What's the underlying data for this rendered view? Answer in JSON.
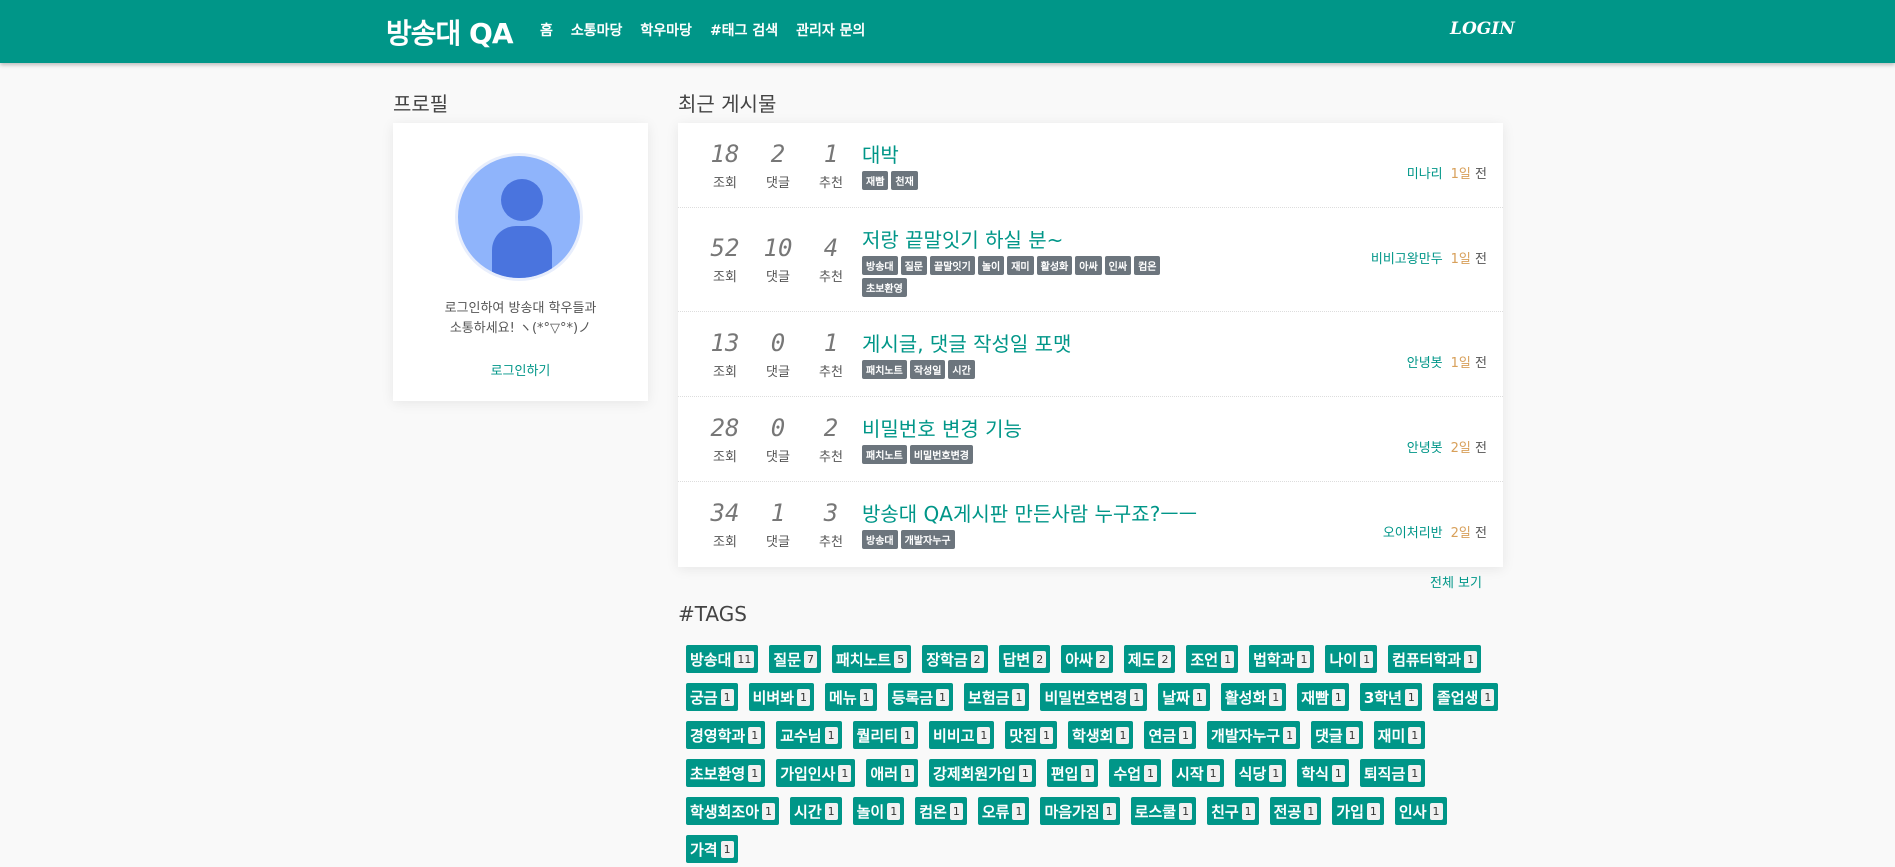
{
  "header": {
    "brand": "방송대 QA",
    "nav": [
      "홈",
      "소통마당",
      "학우마당",
      "#태그 검색",
      "관리자 문의"
    ],
    "login": "LOGIN"
  },
  "profile": {
    "title": "프로필",
    "message_line1": "로그인하여 방송대 학우들과",
    "message_line2": "소통하세요! ヽ(*°▽°*)ノ",
    "login_link": "로그인하기"
  },
  "recent": {
    "title": "최근 게시물",
    "labels": {
      "views": "조회",
      "comments": "댓글",
      "likes": "추천"
    },
    "view_all": "전체 보기",
    "posts": [
      {
        "views": "18",
        "comments": "2",
        "likes": "1",
        "title": "대박",
        "tags": [
          "재빰",
          "천재"
        ],
        "author": "미나리",
        "days": "1일",
        "ago": "전"
      },
      {
        "views": "52",
        "comments": "10",
        "likes": "4",
        "title": "저랑 끝말잇기 하실 분~",
        "tags": [
          "방송대",
          "질문",
          "끝말잇기",
          "놀이",
          "재미",
          "활성화",
          "아싸",
          "인싸",
          "컴온",
          "초보환영"
        ],
        "author": "비비고왕만두",
        "days": "1일",
        "ago": "전"
      },
      {
        "views": "13",
        "comments": "0",
        "likes": "1",
        "title": "게시글, 댓글 작성일 포맷",
        "tags": [
          "패치노트",
          "작성일",
          "시간"
        ],
        "author": "안녕봇",
        "days": "1일",
        "ago": "전"
      },
      {
        "views": "28",
        "comments": "0",
        "likes": "2",
        "title": "비밀번호 변경 기능",
        "tags": [
          "패치노트",
          "비밀번호변경"
        ],
        "author": "안녕봇",
        "days": "2일",
        "ago": "전"
      },
      {
        "views": "34",
        "comments": "1",
        "likes": "3",
        "title": "방송대 QA게시판 만든사람 누구죠?ㅡㅡ",
        "tags": [
          "방송대",
          "개발자누구"
        ],
        "author": "오이처리반",
        "days": "2일",
        "ago": "전"
      }
    ]
  },
  "tags": {
    "title": "#TAGS",
    "items": [
      {
        "name": "방송대",
        "count": "11"
      },
      {
        "name": "질문",
        "count": "7"
      },
      {
        "name": "패치노트",
        "count": "5"
      },
      {
        "name": "장학금",
        "count": "2"
      },
      {
        "name": "답변",
        "count": "2"
      },
      {
        "name": "아싸",
        "count": "2"
      },
      {
        "name": "제도",
        "count": "2"
      },
      {
        "name": "조언",
        "count": "1"
      },
      {
        "name": "법학과",
        "count": "1"
      },
      {
        "name": "나이",
        "count": "1"
      },
      {
        "name": "컴퓨터학과",
        "count": "1"
      },
      {
        "name": "궁금",
        "count": "1"
      },
      {
        "name": "비벼봐",
        "count": "1"
      },
      {
        "name": "메뉴",
        "count": "1"
      },
      {
        "name": "등록금",
        "count": "1"
      },
      {
        "name": "보험금",
        "count": "1"
      },
      {
        "name": "비밀번호변경",
        "count": "1"
      },
      {
        "name": "날짜",
        "count": "1"
      },
      {
        "name": "활성화",
        "count": "1"
      },
      {
        "name": "재빰",
        "count": "1"
      },
      {
        "name": "3학년",
        "count": "1"
      },
      {
        "name": "졸업생",
        "count": "1"
      },
      {
        "name": "경영학과",
        "count": "1"
      },
      {
        "name": "교수님",
        "count": "1"
      },
      {
        "name": "퀄리티",
        "count": "1"
      },
      {
        "name": "비비고",
        "count": "1"
      },
      {
        "name": "맛집",
        "count": "1"
      },
      {
        "name": "학생회",
        "count": "1"
      },
      {
        "name": "연금",
        "count": "1"
      },
      {
        "name": "개발자누구",
        "count": "1"
      },
      {
        "name": "댓글",
        "count": "1"
      },
      {
        "name": "재미",
        "count": "1"
      },
      {
        "name": "초보환영",
        "count": "1"
      },
      {
        "name": "가입인사",
        "count": "1"
      },
      {
        "name": "애러",
        "count": "1"
      },
      {
        "name": "강제회원가입",
        "count": "1"
      },
      {
        "name": "편입",
        "count": "1"
      },
      {
        "name": "수업",
        "count": "1"
      },
      {
        "name": "시작",
        "count": "1"
      },
      {
        "name": "식당",
        "count": "1"
      },
      {
        "name": "학식",
        "count": "1"
      },
      {
        "name": "퇴직금",
        "count": "1"
      },
      {
        "name": "학생회조아",
        "count": "1"
      },
      {
        "name": "시간",
        "count": "1"
      },
      {
        "name": "놀이",
        "count": "1"
      },
      {
        "name": "컴온",
        "count": "1"
      },
      {
        "name": "오류",
        "count": "1"
      },
      {
        "name": "마음가짐",
        "count": "1"
      },
      {
        "name": "로스쿨",
        "count": "1"
      },
      {
        "name": "친구",
        "count": "1"
      },
      {
        "name": "전공",
        "count": "1"
      },
      {
        "name": "가입",
        "count": "1"
      },
      {
        "name": "인사",
        "count": "1"
      },
      {
        "name": "가격",
        "count": "1"
      }
    ]
  },
  "colors": {
    "primary": "#009688",
    "tag_gray": "#6c757d",
    "avatar": "#8fb4fb"
  }
}
